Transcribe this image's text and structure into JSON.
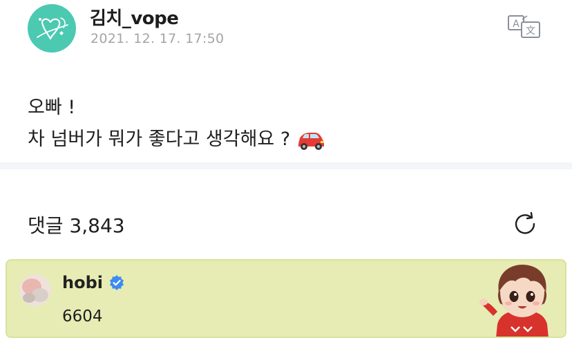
{
  "post": {
    "author": "김치_vope",
    "timestamp": "2021. 12. 17. 17:50",
    "body_line1": "오빠 !",
    "body_line2": "차 넘버가 뭐가 좋다고 생각해요 ?",
    "emoji": "car-emoji",
    "translate_icon": "translate-icon"
  },
  "comments": {
    "title": "댓글 3,843",
    "refresh_icon": "refresh-icon",
    "highlighted": {
      "author": "hobi",
      "verified": true,
      "text": "6604",
      "background": "#e6ecb3"
    }
  },
  "colors": {
    "avatar_bg": "#4cc9b1",
    "timestamp": "#a4a4a4",
    "divider": "#f3f5f8",
    "verified": "#3d8bf2",
    "card_border": "#d7e39a"
  }
}
